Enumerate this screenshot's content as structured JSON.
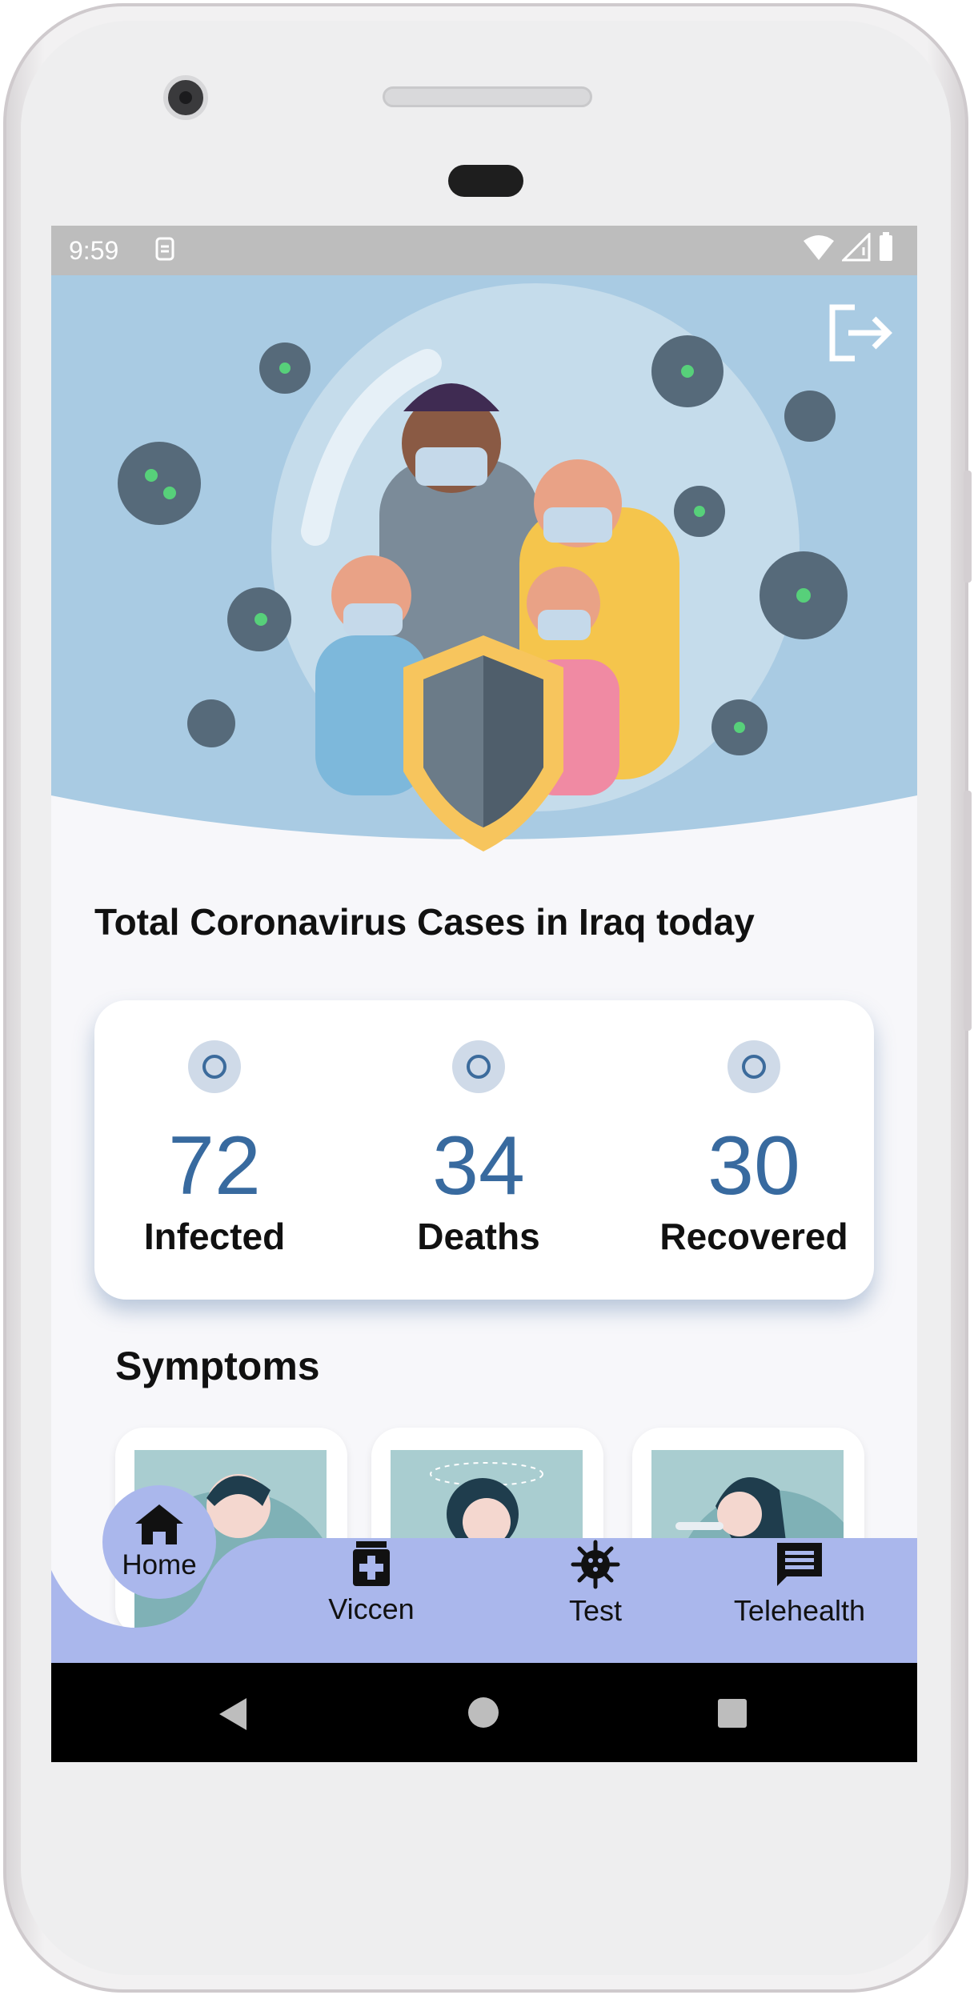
{
  "status_bar": {
    "time": "9:59"
  },
  "hero": {
    "logout_icon": "logout-icon"
  },
  "main": {
    "title": "Total Coronavirus Cases in Iraq today",
    "stats": [
      {
        "value": "72",
        "label": "Infected"
      },
      {
        "value": "34",
        "label": "Deaths"
      },
      {
        "value": "30",
        "label": "Recovered"
      }
    ],
    "symptoms_title": "Symptoms"
  },
  "bottom_nav": {
    "items": [
      {
        "label": "Home",
        "icon": "home-icon"
      },
      {
        "label": "Viccen",
        "icon": "medicine-icon"
      },
      {
        "label": "Test",
        "icon": "virus-icon"
      },
      {
        "label": "Telehealth",
        "icon": "chat-icon"
      }
    ]
  },
  "colors": {
    "accent": "#386a9f",
    "nav": "#aab7ec",
    "hero_bg": "#a9cbe3"
  }
}
